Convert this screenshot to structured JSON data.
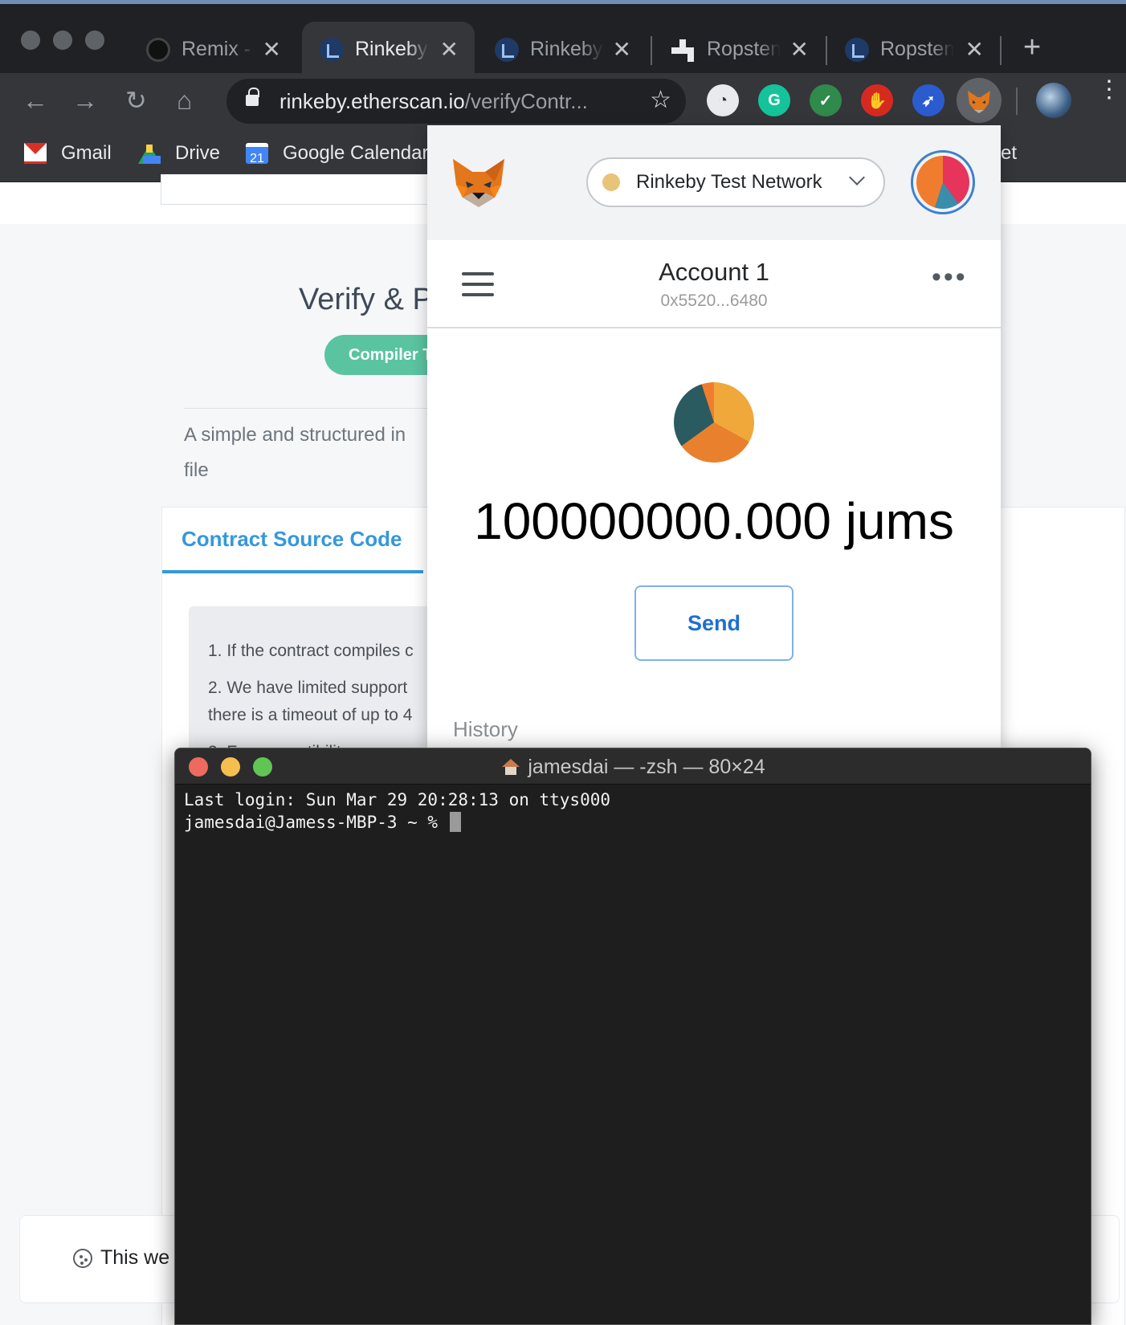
{
  "browser": {
    "tabs": [
      {
        "title": "Remix -",
        "icon": "remix-icon",
        "active": false
      },
      {
        "title": "Rinkeby",
        "icon": "etherscan-icon",
        "active": true
      },
      {
        "title": "Rinkeby",
        "icon": "etherscan-icon",
        "active": false
      },
      {
        "title": "Ropsten",
        "icon": "faucet-icon",
        "active": false
      },
      {
        "title": "Ropsten",
        "icon": "etherscan-icon",
        "active": false
      }
    ],
    "tab_close_glyph": "✕",
    "new_tab_glyph": "+",
    "url_domain": "rinkeby.etherscan.io",
    "url_path": "/verifyContr...",
    "bookmarks": [
      {
        "label": "Gmail",
        "icon": "gmail-icon"
      },
      {
        "label": "Drive",
        "icon": "drive-icon"
      },
      {
        "label": "Google Calendar",
        "icon": "calendar-icon",
        "badge": "21"
      },
      {
        "label": "et",
        "icon": ""
      }
    ]
  },
  "page": {
    "title": "Verify & P",
    "compiler_pill": "Compiler T",
    "description": "A simple and structured in file",
    "source_tab": "Contract Source Code",
    "info_lines": [
      "1. If the contract compiles c",
      "2. We have limited support",
      "there is a timeout of up to 4",
      "3. For compatibility..."
    ],
    "cookie_text": "This we"
  },
  "metamask": {
    "network": "Rinkeby Test Network",
    "account_name": "Account 1",
    "account_address": "0x5520...6480",
    "balance": "100000000.000",
    "token_symbol": "jums",
    "send_label": "Send",
    "history_label": "History",
    "more_glyph": "•••"
  },
  "terminal": {
    "title": "jamesdai — -zsh — 80×24",
    "lines": [
      "Last login: Sun Mar 29 20:28:13 on ttys000",
      "jamesdai@Jamess-MBP-3 ~ % "
    ]
  },
  "colors": {
    "tab_bar": "#202124",
    "toolbar": "#35363a",
    "accent_blue": "#3498db",
    "pill_green": "#5ac4a0",
    "network_dot": "#e8c479",
    "send_border": "#7fb1ea",
    "terminal_bg": "#1e1e1e",
    "close_red": "#ed6a5e",
    "minimize_yellow": "#f5bf4f",
    "zoom_green": "#61c554"
  }
}
